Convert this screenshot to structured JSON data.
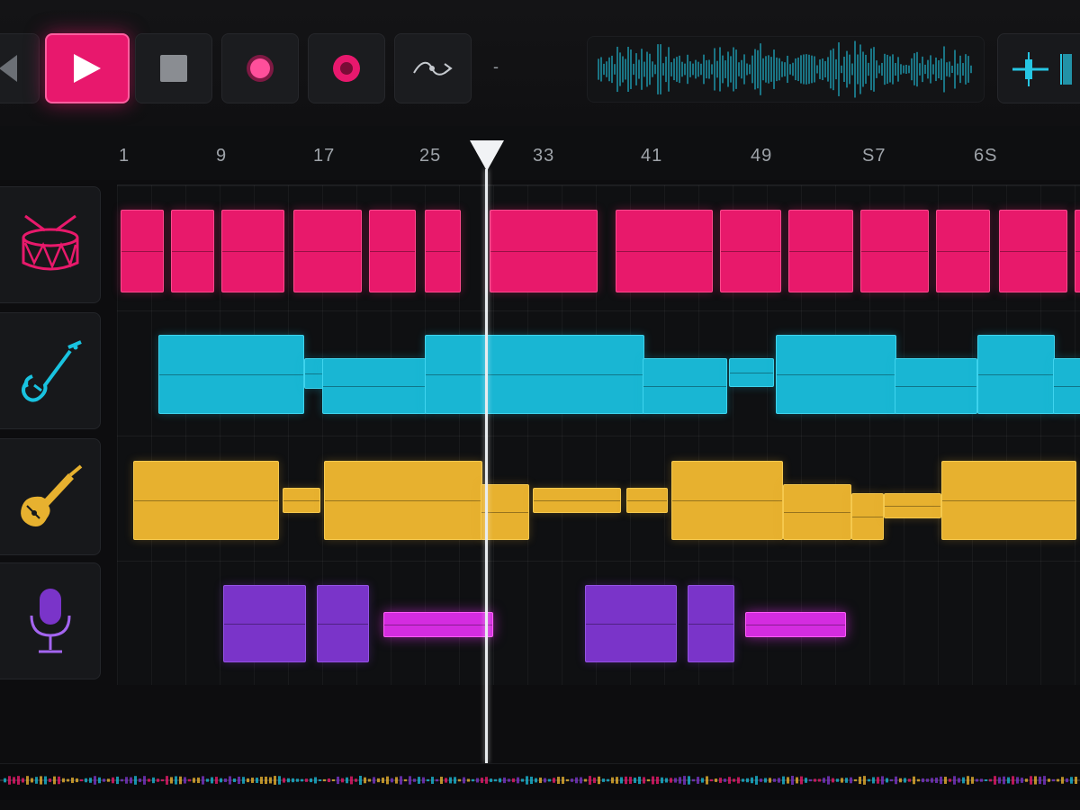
{
  "colors": {
    "accent": "#e8186d",
    "drums": "#e8196b",
    "bass": "#19b6d3",
    "guitar": "#e7b12f",
    "vocals": "#7a34c9",
    "vocal_fx": "#d42ce0",
    "playhead": "#f1f3f5"
  },
  "transport": {
    "buttons": [
      {
        "name": "rewind-button",
        "icon": "rewind-icon"
      },
      {
        "name": "play-button",
        "icon": "play-icon",
        "active": true
      },
      {
        "name": "stop-button",
        "icon": "stop-icon"
      },
      {
        "name": "record-button",
        "icon": "record-icon"
      },
      {
        "name": "record-arm-button",
        "icon": "record-arm-icon"
      },
      {
        "name": "loop-button",
        "icon": "loop-arrow-icon"
      }
    ],
    "separator_text": "-",
    "tempo_icon": "metronome-icon"
  },
  "ruler": {
    "bars": [
      "1",
      "9",
      "17",
      "25",
      "33",
      "41",
      "49",
      "S7",
      "6S"
    ]
  },
  "tracks": [
    {
      "id": "drums",
      "icon": "drum-icon"
    },
    {
      "id": "bass",
      "icon": "bass-guitar-icon"
    },
    {
      "id": "guitar",
      "icon": "electric-guitar-icon"
    },
    {
      "id": "vocals",
      "icon": "microphone-icon"
    }
  ],
  "playhead": {
    "bar": 31
  }
}
